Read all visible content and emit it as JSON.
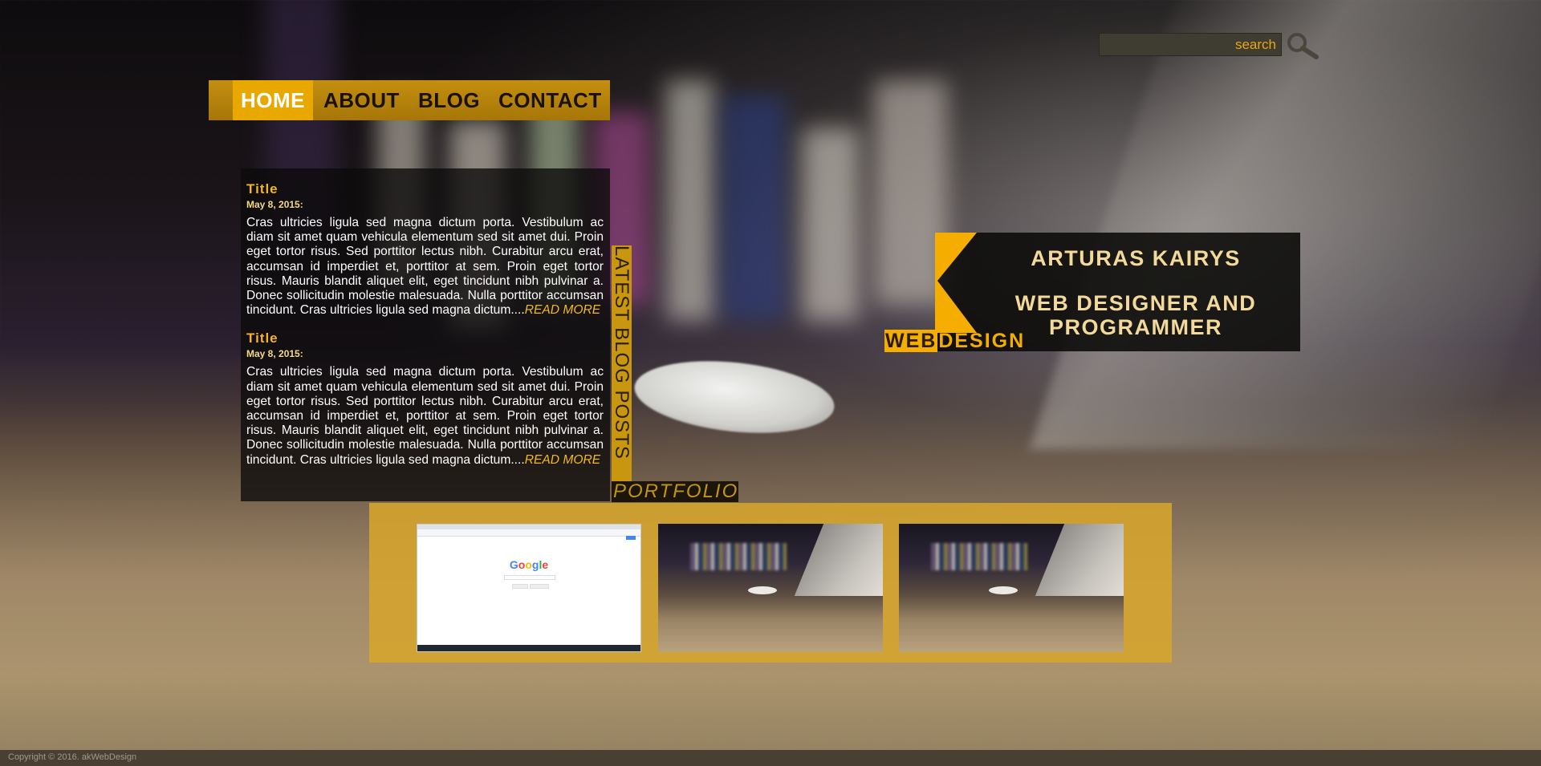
{
  "search": {
    "placeholder": "search"
  },
  "nav": {
    "items": [
      {
        "label": "HOME",
        "active": true
      },
      {
        "label": "ABOUT",
        "active": false
      },
      {
        "label": "BLOG",
        "active": false
      },
      {
        "label": "CONTACT",
        "active": false
      }
    ]
  },
  "blog": {
    "section_label": "LATEST BLOG POSTS",
    "read_more": "READ MORE",
    "posts": [
      {
        "title": "Title",
        "date": "May 8, 2015:",
        "body": "Cras ultricies ligula sed magna dictum porta. Vestibulum ac diam sit amet quam vehicula elementum sed sit amet dui. Proin eget tortor risus. Sed porttitor lectus nibh. Curabitur arcu erat, accumsan id imperdiet et, porttitor at sem. Proin eget tortor risus. Mauris blandit aliquet elit, eget tincidunt nibh pulvinar a. Donec sollicitudin molestie malesuada. Nulla porttitor accumsan tincidunt. Cras ultricies ligula sed magna dictum...."
      },
      {
        "title": "Title",
        "date": "May 8, 2015:",
        "body": "Cras ultricies ligula sed magna dictum porta. Vestibulum ac diam sit amet quam vehicula elementum sed sit amet dui. Proin eget tortor risus. Sed porttitor lectus nibh. Curabitur arcu erat, accumsan id imperdiet et, porttitor at sem. Proin eget tortor risus. Mauris blandit aliquet elit, eget tincidunt nibh pulvinar a. Donec sollicitudin molestie malesuada. Nulla porttitor accumsan tincidunt. Cras ultricies ligula sed magna dictum...."
      }
    ]
  },
  "portfolio": {
    "label": "PORTFOLIO",
    "browser_thumb": {
      "logo": [
        "G",
        "o",
        "o",
        "g",
        "l",
        "e"
      ]
    },
    "items": [
      "browser-screenshot",
      "desk-photo",
      "desk-photo"
    ]
  },
  "brand": {
    "name": "ARTURAS KAIRYS",
    "role": "WEB DESIGNER AND PROGRAMMER",
    "logo_word_part1": "WEB",
    "logo_word_part2": "DESIGN",
    "accent_color": "#f5ad00"
  },
  "footer": {
    "copyright": "Copyright © 2016. akWebDesign"
  },
  "icons": {
    "search": "magnifier-icon",
    "logo": "k-logo-icon"
  },
  "colors": {
    "nav_bg": "#c48f10",
    "nav_active": "#e8a800",
    "text_gold": "#f5b521",
    "panel_bg": "#0c0a0a"
  }
}
